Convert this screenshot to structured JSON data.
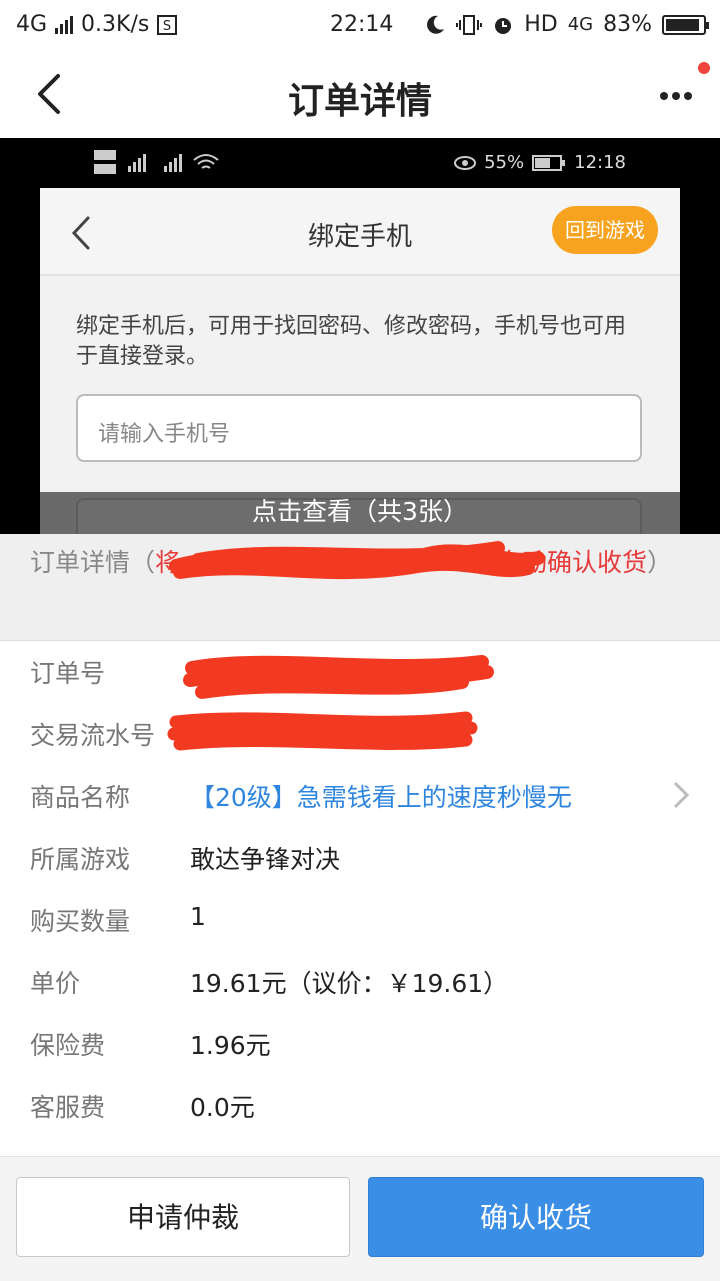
{
  "status_bar": {
    "network": "4G",
    "speed": "0.3K/s",
    "time": "22:14",
    "hd": "HD",
    "net2": "4G",
    "battery": "83%",
    "battery_level": 0.83
  },
  "header": {
    "title": "订单详情"
  },
  "preview": {
    "phone_battery": "55%",
    "phone_time": "12:18",
    "inner_title": "绑定手机",
    "back_to_game": "回到游戏",
    "description": "绑定手机后，可用于找回密码、修改密码，手机号也可用于直接登录。",
    "phone_placeholder": "请输入手机号",
    "overlay_text": "点击查看（共3张）"
  },
  "notice": {
    "label": "订单详情",
    "paren_open": "（",
    "red_start": "将",
    "red_end": "后自动确认收货",
    "paren_close": "）"
  },
  "details": {
    "order_no_label": "订单号",
    "serial_label": "交易流水号",
    "product_label": "商品名称",
    "product_value": "【20级】急需钱看上的速度秒慢无",
    "game_label": "所属游戏",
    "game_value": "敢达争锋对决",
    "qty_label": "购买数量",
    "qty_value": "1",
    "price_label": "单价",
    "price_value": "19.61元（议价：￥19.61）",
    "insurance_label": "保险费",
    "insurance_value": "1.96元",
    "service_label": "客服费",
    "service_value": "0.0元"
  },
  "actions": {
    "arbitrate": "申请仲裁",
    "confirm": "确认收货"
  },
  "colors": {
    "accent_blue": "#3a8ee6",
    "link_blue": "#2f86de",
    "red": "#e83a3a",
    "orange": "#f7a31f"
  }
}
